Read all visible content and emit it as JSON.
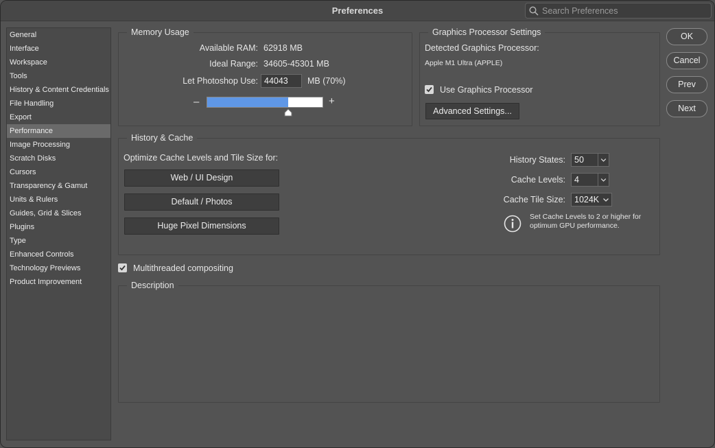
{
  "window": {
    "title": "Preferences"
  },
  "search": {
    "placeholder": "Search Preferences"
  },
  "sidebar": {
    "items": [
      {
        "label": "General"
      },
      {
        "label": "Interface"
      },
      {
        "label": "Workspace"
      },
      {
        "label": "Tools"
      },
      {
        "label": "History & Content Credentials"
      },
      {
        "label": "File Handling"
      },
      {
        "label": "Export"
      },
      {
        "label": "Performance",
        "active": true
      },
      {
        "label": "Image Processing"
      },
      {
        "label": "Scratch Disks"
      },
      {
        "label": "Cursors"
      },
      {
        "label": "Transparency & Gamut"
      },
      {
        "label": "Units & Rulers"
      },
      {
        "label": "Guides, Grid & Slices"
      },
      {
        "label": "Plugins"
      },
      {
        "label": "Type"
      },
      {
        "label": "Enhanced Controls"
      },
      {
        "label": "Technology Previews"
      },
      {
        "label": "Product Improvement"
      }
    ]
  },
  "memory": {
    "title": "Memory Usage",
    "available_label": "Available RAM:",
    "available_value": "62918 MB",
    "ideal_label": "Ideal Range:",
    "ideal_value": "34605-45301 MB",
    "let_use_label": "Let Photoshop Use:",
    "let_use_value": "44043",
    "let_use_unit": "MB (70%)",
    "slider_fraction": 0.7,
    "minus": "–",
    "plus": "+"
  },
  "gpu": {
    "title": "Graphics Processor Settings",
    "detected_label": "Detected Graphics Processor:",
    "detected_value": "Apple M1 Ultra (APPLE)",
    "use_gpu_label": "Use Graphics Processor",
    "use_gpu_checked": true,
    "advanced_button": "Advanced Settings..."
  },
  "history_cache": {
    "title": "History & Cache",
    "optimize_label": "Optimize Cache Levels and Tile Size for:",
    "buttons": [
      "Web / UI Design",
      "Default / Photos",
      "Huge Pixel Dimensions"
    ],
    "history_states_label": "History States:",
    "history_states_value": "50",
    "cache_levels_label": "Cache Levels:",
    "cache_levels_value": "4",
    "tile_size_label": "Cache Tile Size:",
    "tile_size_value": "1024K",
    "info_line1": "Set Cache Levels to 2 or higher for",
    "info_line2": "optimum GPU performance."
  },
  "multithread": {
    "label": "Multithreaded compositing",
    "checked": true
  },
  "description": {
    "title": "Description"
  },
  "actions": {
    "ok": "OK",
    "cancel": "Cancel",
    "prev": "Prev",
    "next": "Next"
  },
  "colors": {
    "accent": "#5f97e6",
    "background": "#535353",
    "panel_border": "#444444"
  }
}
